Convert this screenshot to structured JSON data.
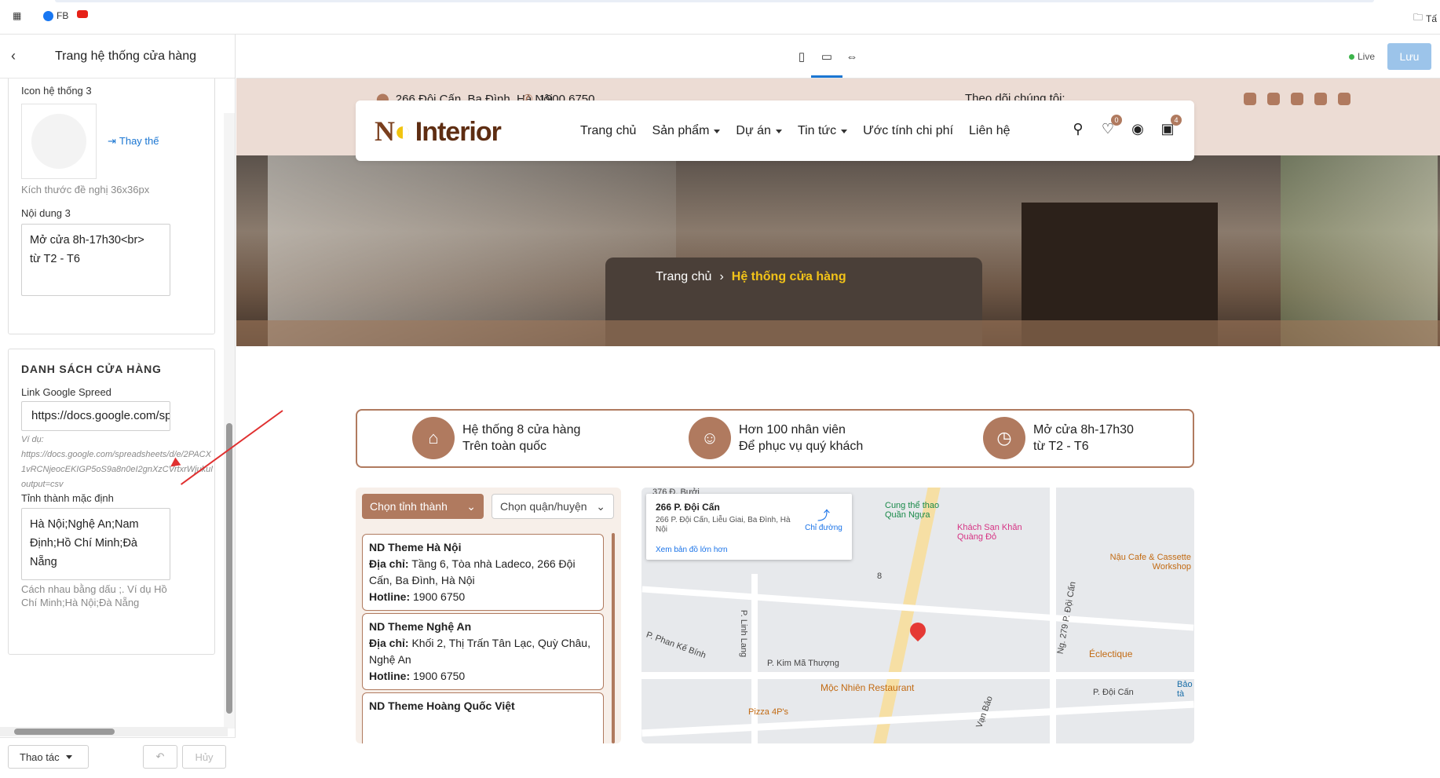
{
  "topbar": {
    "fb_label": "FB",
    "folder_label": "Tấ"
  },
  "panel": {
    "title": "Trang hệ thống cửa hàng",
    "icon3_label": "Icon hệ thống 3",
    "replace_label": "Thay thế",
    "size_hint": "Kích thước đề nghị 36x36px",
    "content3_label": "Nội dung 3",
    "content3_value": "Mở cửa 8h-17h30<br>\ntừ T2 - T6",
    "section_title": "DANH SÁCH CỬA HÀNG",
    "sheet_label": "Link Google Spreed",
    "sheet_value": "https://docs.google.com/sp",
    "example": "Ví dụ:\nhttps://docs.google.com/spreadsheets/d/e/2PACX\n1vRCNjeocEKIGP5oS9a8n0eI2gnXzCVrtxrWjukuM\noutput=csv",
    "province_label": "Tỉnh thành mặc định",
    "province_value": "Hà Nội;Nghệ An;Nam Định;Hồ Chí Minh;Đà Nẵng",
    "province_hint": "Cách nhau bằng dấu ;. Ví dụ Hồ Chí Minh;Hà Nội;Đà Nẵng",
    "action_label": "Thao tác",
    "cancel_label": "Hủy"
  },
  "editor": {
    "live_label": "Live",
    "save_label": "Lưu"
  },
  "site": {
    "address": "266 Đội Cấn, Ba Đình, Hà Nội",
    "phone": "1900 6750",
    "follow_label": "Theo dõi chúng tôi:",
    "logo_main": "N",
    "logo_word": "Interior",
    "nav": [
      "Trang chủ",
      "Sản phẩm",
      "Dự án",
      "Tin tức",
      "Ước tính chi phí",
      "Liên hệ"
    ],
    "wishlist_count": "0",
    "cart_count": "4",
    "breadcrumb_home": "Trang chủ",
    "breadcrumb_current": "Hệ thống cửa hàng",
    "features": [
      {
        "line1": "Hệ thống 8 cửa hàng",
        "line2": "Trên toàn quốc"
      },
      {
        "line1": "Hơn 100 nhân viên",
        "line2": "Để phục vụ quý khách"
      },
      {
        "line1": "Mở cửa 8h-17h30",
        "line2": "từ T2 - T6"
      }
    ],
    "select_province": "Chọn tỉnh thành",
    "select_district": "Chọn quận/huyện",
    "addr_label": "Địa chỉ:",
    "hotline_label": "Hotline:",
    "stores": [
      {
        "name": "ND Theme Hà Nội",
        "address": "Tầng 6, Tòa nhà Ladeco, 266 Đội Cấn, Ba Đình, Hà Nội",
        "hotline": "1900 6750"
      },
      {
        "name": "ND Theme Nghệ An",
        "address": "Khối 2, Thị Trấn Tân Lạc, Quỳ Châu, Nghệ An",
        "hotline": "1900 6750"
      },
      {
        "name": "ND Theme Hoàng Quốc Việt",
        "address": "",
        "hotline": ""
      }
    ],
    "map": {
      "place_name": "266 P. Đội Cấn",
      "place_address": "266 P. Đội Cấn, Liễu Giai, Ba Đình, Hà Nội",
      "directions": "Chỉ đường",
      "larger_map": "Xem bản đồ lớn hơn",
      "labels": [
        "Cung thể thao Quần Ngựa",
        "Khách Sạn Khăn Quàng Đỏ",
        "Nậu Cafe & Cassette Workshop",
        "Éclectique",
        "Mộc Nhiên Restaurant",
        "P. Kim Mã Thượng",
        "P. Linh Lang",
        "P. Phan Kế Bính",
        "P. Đội Cấn",
        "Ng. 279 P. Đội Cấn",
        "Pizza 4P's",
        "Bảo tà",
        "376 Đ. Bưởi",
        "8",
        "Vạn Bảo"
      ]
    }
  }
}
